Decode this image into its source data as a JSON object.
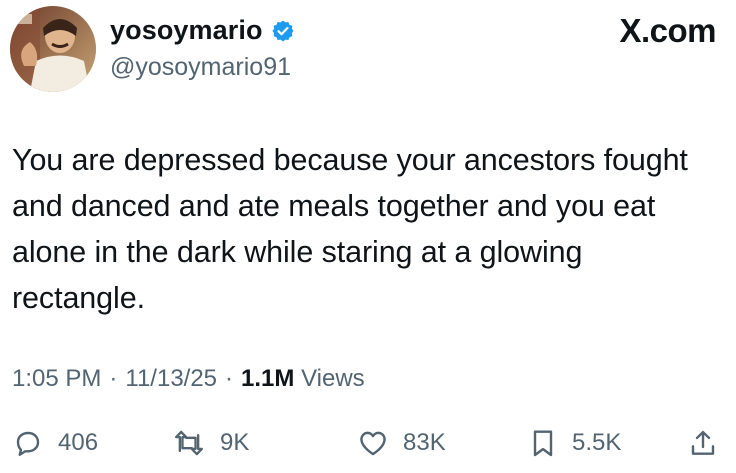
{
  "header": {
    "display_name": "yosoymario",
    "handle": "@yosoymario91",
    "verified_icon": "verified-badge-icon",
    "brand": "X.com"
  },
  "tweet": {
    "text": "You are depressed because your ancestors fought and danced and ate meals together and you eat alone in the dark while staring at a glowing rectangle."
  },
  "meta": {
    "time": "1:05 PM",
    "separator": "·",
    "date": "11/13/25",
    "views_count": "1.1M",
    "views_label": "Views"
  },
  "actions": {
    "replies": "406",
    "reposts": "9K",
    "likes": "83K",
    "bookmarks": "5.5K"
  },
  "colors": {
    "text": "#0f1419",
    "secondary": "#536471",
    "verified": "#1d9bf0"
  }
}
